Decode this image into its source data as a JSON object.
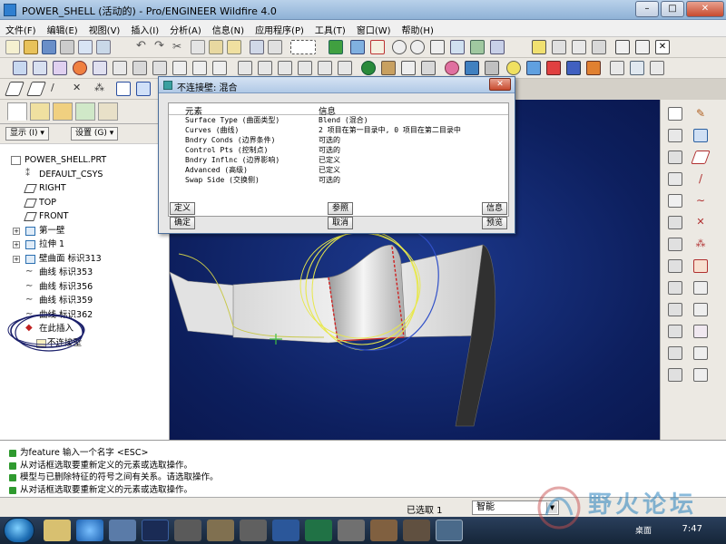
{
  "window": {
    "title": "POWER_SHELL (活动的) - Pro/ENGINEER Wildfire 4.0",
    "controls": [
      "–",
      "□",
      "✕"
    ]
  },
  "menubar": {
    "items": [
      "文件(F)",
      "编辑(E)",
      "视图(V)",
      "插入(I)",
      "分析(A)",
      "信息(N)",
      "应用程序(P)",
      "工具(T)",
      "窗口(W)",
      "帮助(H)"
    ]
  },
  "model_tree": {
    "display_label": "显示 (I) ▾",
    "settings_label": "设置 (G) ▾",
    "items": [
      {
        "label": "POWER_SHELL.PRT",
        "icon": "part-icon"
      },
      {
        "label": "DEFAULT_CSYS",
        "icon": "csys-icon"
      },
      {
        "label": "RIGHT",
        "icon": "datum-plane-icon"
      },
      {
        "label": "TOP",
        "icon": "datum-plane-icon"
      },
      {
        "label": "FRONT",
        "icon": "datum-plane-icon"
      },
      {
        "label": "第一壁",
        "icon": "feature-icon"
      },
      {
        "label": "拉伸 1",
        "icon": "extrude-icon"
      },
      {
        "label": "壁曲面 标识313",
        "icon": "feature-icon"
      },
      {
        "label": "曲线 标识353",
        "icon": "curve-icon"
      },
      {
        "label": "曲线 标识356",
        "icon": "curve-icon"
      },
      {
        "label": "曲线 标识359",
        "icon": "curve-icon"
      },
      {
        "label": "曲线 标识362",
        "icon": "curve-icon"
      },
      {
        "label": "在此插入",
        "icon": "insert-here-icon"
      },
      {
        "label": "不连接壁",
        "icon": "unattached-wall-icon"
      }
    ]
  },
  "dialog": {
    "title": "不连接壁: 混合",
    "headers": {
      "element": "元素",
      "info": "信息"
    },
    "rows": [
      {
        "element": "Surface Type (曲面类型)",
        "info": "Blend (混合)"
      },
      {
        "element": "Curves (曲线)",
        "info": "2 项目在第一目录中, 0 项目在第二目录中"
      },
      {
        "element": "Bndry Conds (边界条件)",
        "info": "可选的"
      },
      {
        "element": "Control Pts (控制点)",
        "info": "可选的"
      },
      {
        "element": "Bndry Inflnc (边界影响)",
        "info": "已定义"
      },
      {
        "element": "Advanced (高级)",
        "info": "已定义"
      },
      {
        "element": "Swap Side (交换侧)",
        "info": "可选的"
      }
    ],
    "buttons": {
      "define": "定义",
      "refs": "参照",
      "info": "信息",
      "ok": "确定",
      "cancel": "取消",
      "preview": "预览"
    }
  },
  "messages": [
    "为feature 输入一个名字  <ESC>",
    "从对话框选取要重新定义的元素或选取操作。",
    "模型与已删除特征的符号之间有关系。请选取操作。",
    "从对话框选取要重新定义的元素或选取操作。"
  ],
  "status": {
    "selected": "已选取 1",
    "filter": "智能"
  },
  "taskbar": {
    "desktop_label": "桌面",
    "time": "7:47"
  },
  "watermark": {
    "text": "野火论坛"
  },
  "colors": {
    "viewport_bg": "#0d1f5e",
    "curve_yellow": "#e8e84a",
    "curve_blue": "#3050c8",
    "edge_red": "#d02020"
  }
}
